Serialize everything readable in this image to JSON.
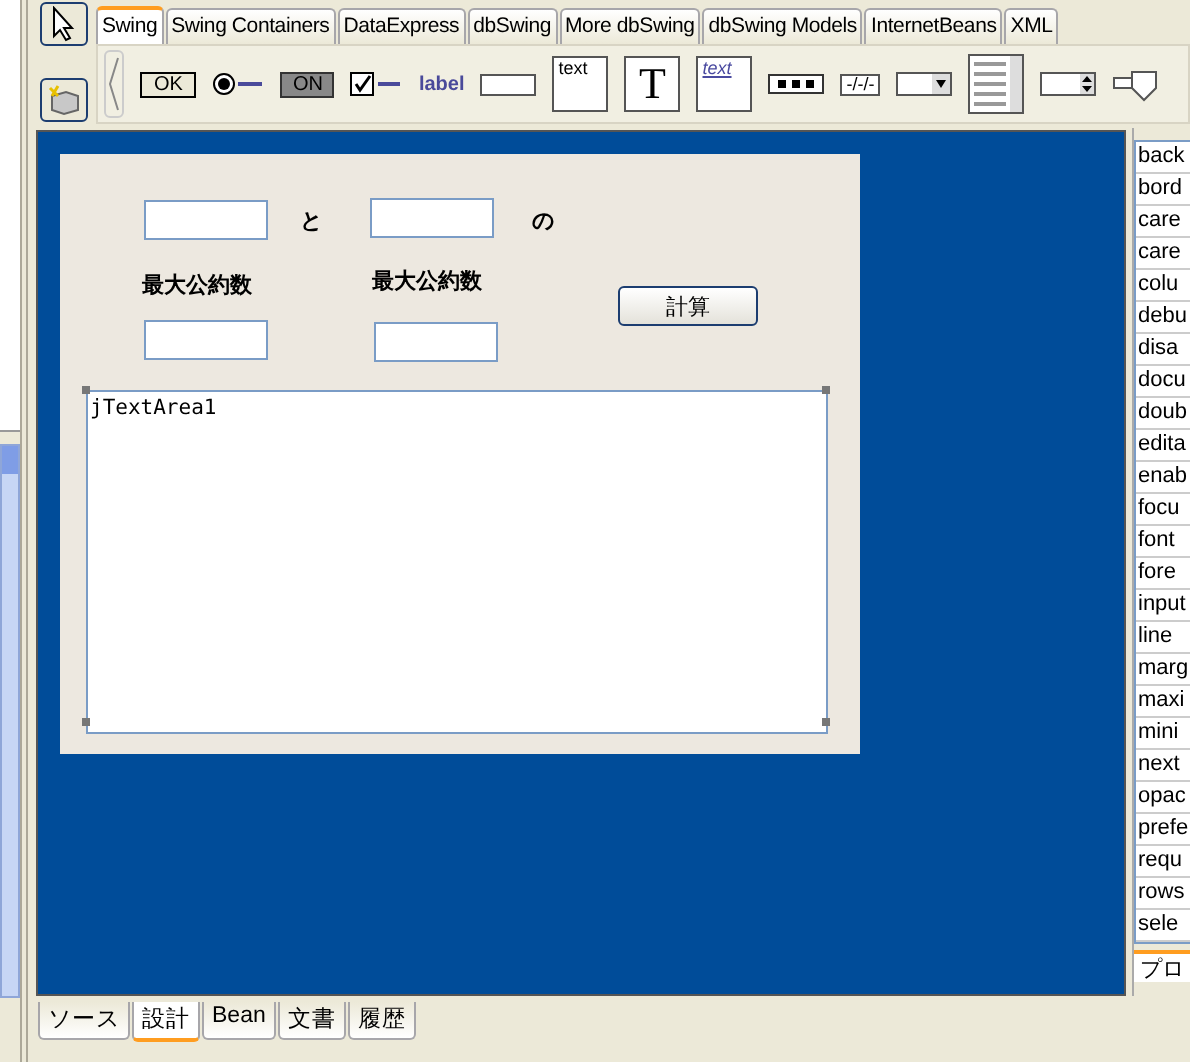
{
  "component_tabs": [
    {
      "label": "Swing",
      "selected": true
    },
    {
      "label": "Swing Containers",
      "selected": false
    },
    {
      "label": "DataExpress",
      "selected": false
    },
    {
      "label": "dbSwing",
      "selected": false
    },
    {
      "label": "More dbSwing",
      "selected": false
    },
    {
      "label": "dbSwing Models",
      "selected": false
    },
    {
      "label": "InternetBeans",
      "selected": false
    },
    {
      "label": "XML",
      "selected": false
    }
  ],
  "palette": [
    {
      "kind": "button",
      "label": "OK"
    },
    {
      "kind": "radio"
    },
    {
      "kind": "toggle",
      "label": "ON"
    },
    {
      "kind": "checkbox"
    },
    {
      "kind": "label",
      "label": "label"
    },
    {
      "kind": "textfield"
    },
    {
      "kind": "textarea",
      "label": "text"
    },
    {
      "kind": "textpane",
      "label": "T"
    },
    {
      "kind": "editorpane",
      "label": "text"
    },
    {
      "kind": "password"
    },
    {
      "kind": "formatted",
      "label": "-/-/-"
    },
    {
      "kind": "combo"
    },
    {
      "kind": "list"
    },
    {
      "kind": "spinner"
    },
    {
      "kind": "slider"
    }
  ],
  "form": {
    "connector_1": "と",
    "connector_2": "の",
    "result_labels": [
      "最大公約数",
      "最大公約数"
    ],
    "button": "計算",
    "text_area": {
      "value": "jTextArea1",
      "selected": true
    }
  },
  "properties": [
    "back",
    "bord",
    "care",
    "care",
    "colu",
    "debu",
    "disa",
    "docu",
    "doub",
    "edita",
    "enab",
    "focu",
    "font",
    "fore",
    "input",
    "line",
    "marg",
    "maxi",
    "mini",
    "next",
    "opac",
    "prefe",
    "requ",
    "rows",
    "sele"
  ],
  "properties_tab": "プロ",
  "view_tabs": [
    {
      "label": "ソース",
      "selected": false
    },
    {
      "label": "設計",
      "selected": true
    },
    {
      "label": "Bean",
      "selected": false
    },
    {
      "label": "文書",
      "selected": false
    },
    {
      "label": "履歴",
      "selected": false
    }
  ]
}
